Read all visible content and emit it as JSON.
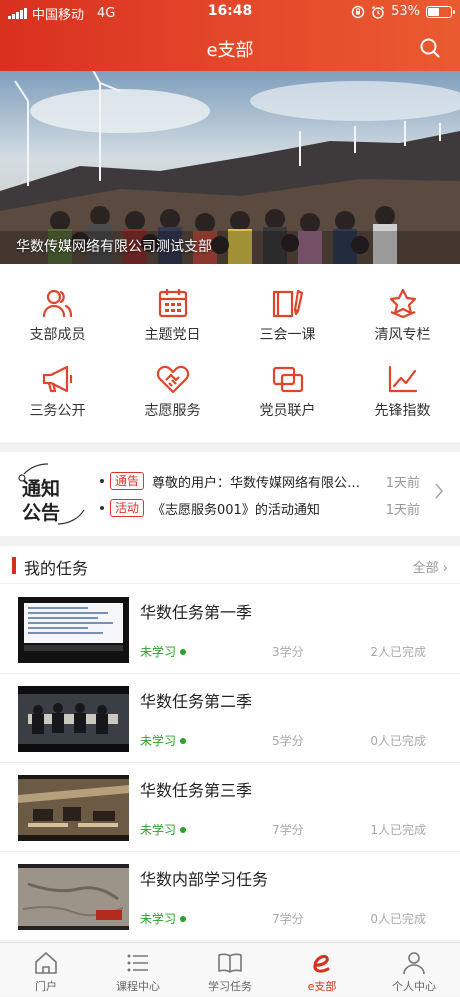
{
  "status": {
    "carrier": "中国移动",
    "network": "4G",
    "time": "16:48",
    "battery": "53%",
    "battery_level": 0.53
  },
  "header": {
    "title": "e支部"
  },
  "hero": {
    "caption": "华数传媒网络有限公司测试支部"
  },
  "grid": [
    {
      "label": "支部成员",
      "icon": "members-icon"
    },
    {
      "label": "主题党日",
      "icon": "calendar-icon"
    },
    {
      "label": "三会一课",
      "icon": "notebook-pen-icon"
    },
    {
      "label": "清风专栏",
      "icon": "badge-star-icon"
    },
    {
      "label": "三务公开",
      "icon": "megaphone-icon"
    },
    {
      "label": "志愿服务",
      "icon": "heart-handshake-icon"
    },
    {
      "label": "党员联户",
      "icon": "linked-squares-icon"
    },
    {
      "label": "先锋指数",
      "icon": "trend-chart-icon"
    }
  ],
  "notice": {
    "logo_line1": "通知",
    "logo_line2": "公告",
    "items": [
      {
        "tag": "通告",
        "text": "尊敬的用户：华数传媒网络有限公司测试支部",
        "time": "1天前"
      },
      {
        "tag": "活动",
        "text": "《志愿服务001》的活动通知",
        "time": "1天前"
      }
    ]
  },
  "tasks": {
    "heading": "我的任务",
    "all_label": "全部",
    "items": [
      {
        "name": "华数任务第一季",
        "status": "未学习",
        "credits": "3学分",
        "done": "2人已完成"
      },
      {
        "name": "华数任务第二季",
        "status": "未学习",
        "credits": "5学分",
        "done": "0人已完成"
      },
      {
        "name": "华数任务第三季",
        "status": "未学习",
        "credits": "7学分",
        "done": "1人已完成"
      },
      {
        "name": "华数内部学习任务",
        "status": "未学习",
        "credits": "7学分",
        "done": "0人已完成"
      }
    ]
  },
  "tabbar": [
    {
      "label": "门户",
      "icon": "home-icon"
    },
    {
      "label": "课程中心",
      "icon": "list-icon"
    },
    {
      "label": "学习任务",
      "icon": "book-icon"
    },
    {
      "label": "e支部",
      "icon": "e-branch-icon",
      "active": true
    },
    {
      "label": "个人中心",
      "icon": "person-icon"
    }
  ],
  "colors": {
    "accent": "#d8301f",
    "green": "#2aa22a"
  }
}
